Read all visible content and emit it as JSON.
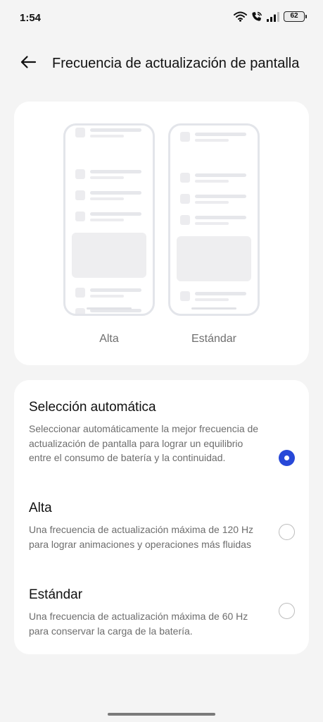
{
  "status_bar": {
    "time": "1:54",
    "battery": "62",
    "icons": [
      "wifi-icon",
      "wifi-calling-icon",
      "signal-icon",
      "battery-icon"
    ]
  },
  "header": {
    "title": "Frecuencia de actualización de pantalla",
    "back_icon": "arrow-left-icon"
  },
  "preview": {
    "labels": [
      "Alta",
      "Estándar"
    ]
  },
  "options": [
    {
      "title": "Selección automática",
      "description": "Seleccionar automáticamente la mejor frecuencia de actualización de pantalla para lograr un equilibrio entre el consumo de batería y la continuidad.",
      "selected": true
    },
    {
      "title": "Alta",
      "description": "Una frecuencia de actualización máxima de 120 Hz para lograr animaciones y operaciones más fluidas",
      "selected": false
    },
    {
      "title": "Estándar",
      "description": "Una frecuencia de actualización máxima de 60 Hz para conservar la carga de la batería.",
      "selected": false
    }
  ],
  "colors": {
    "accent": "#2748d8",
    "background": "#f4f4f4",
    "card": "#ffffff"
  }
}
